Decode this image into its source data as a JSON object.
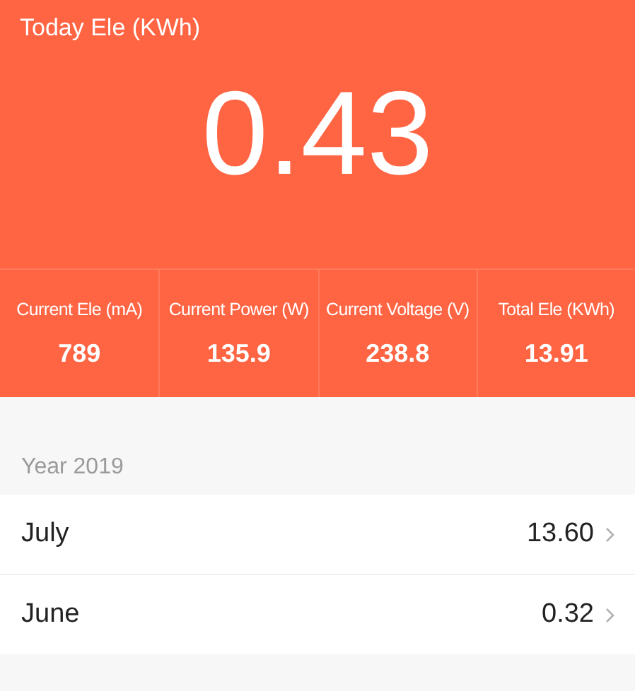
{
  "header": {
    "title": "Today Ele (KWh)",
    "value": "0.43"
  },
  "stats": [
    {
      "label": "Current Ele (mA)",
      "value": "789"
    },
    {
      "label": "Current Power (W)",
      "value": "135.9"
    },
    {
      "label": "Current Voltage (V)",
      "value": "238.8"
    },
    {
      "label": "Total Ele (KWh)",
      "value": "13.91"
    }
  ],
  "section": {
    "title": "Year 2019"
  },
  "months": [
    {
      "name": "July",
      "value": "13.60"
    },
    {
      "name": "June",
      "value": "0.32"
    }
  ]
}
